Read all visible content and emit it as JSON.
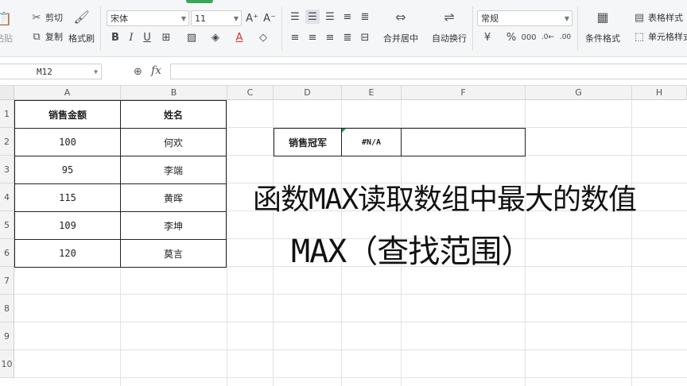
{
  "ribbon": {
    "paste_label": "粘贴",
    "cut_label": "剪切",
    "copy_label": "复制",
    "format_painter_label": "格式刷",
    "font_name": "宋体",
    "font_size": "11",
    "merge_center_label": "合并居中",
    "wrap_text_label": "自动换行",
    "number_format": "常规",
    "conditional_format_label": "条件格式",
    "table_style_label": "表格样式",
    "cell_style_label": "单元格样式"
  },
  "formula_bar": {
    "name_box": "M12",
    "fx_label": "fx",
    "formula": ""
  },
  "sheet": {
    "columns": [
      "A",
      "B",
      "C",
      "D",
      "E",
      "F",
      "G",
      "H"
    ],
    "rows": [
      "1",
      "2",
      "3",
      "4",
      "5",
      "6",
      "7",
      "8",
      "9",
      "10"
    ],
    "table_headers": [
      "销售金额",
      "姓名"
    ],
    "table_rows": [
      [
        "100",
        "何欢"
      ],
      [
        "95",
        "李端"
      ],
      [
        "115",
        "黄晖"
      ],
      [
        "109",
        "李坤"
      ],
      [
        "120",
        "莫言"
      ]
    ],
    "champion_label": "销售冠军",
    "champion_value": "#N/A",
    "champion_extra": ""
  },
  "captions": {
    "line1": "函数MAX读取数组中最大的数值",
    "line2": "MAX（查找范围）"
  },
  "colors": {
    "accent_green": "#3aa858",
    "font_color_red": "#e0312f"
  }
}
